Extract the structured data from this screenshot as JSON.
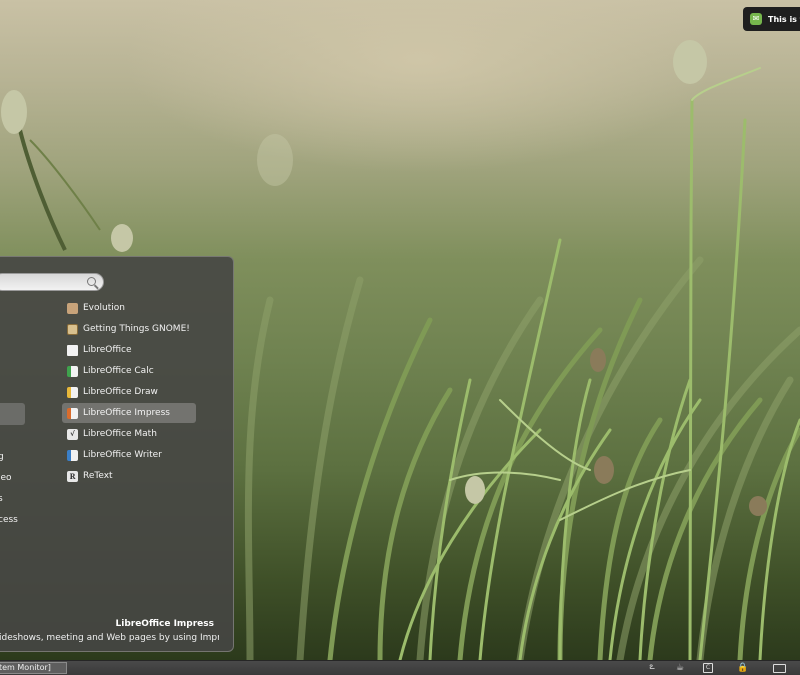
{
  "notification": {
    "text": "This is th",
    "icon": "chat-bubble-icon"
  },
  "menu": {
    "search": {
      "value": "",
      "placeholder": ""
    },
    "categories": [
      {
        "label": "g"
      },
      {
        "label": "leo"
      },
      {
        "label": "s"
      },
      {
        "label": "cess"
      }
    ],
    "applications": [
      {
        "label": "Evolution",
        "icon": "evolution-icon",
        "icon_color": "#c8a37a"
      },
      {
        "label": "Getting Things GNOME!",
        "icon": "gtg-icon",
        "icon_color": "#d8c08e"
      },
      {
        "label": "LibreOffice",
        "icon": "libreoffice-icon",
        "icon_color": "#f2f2f2"
      },
      {
        "label": "LibreOffice Calc",
        "icon": "libreoffice-calc-icon",
        "icon_color": "#3fa34d"
      },
      {
        "label": "LibreOffice Draw",
        "icon": "libreoffice-draw-icon",
        "icon_color": "#e8b83a"
      },
      {
        "label": "LibreOffice Impress",
        "icon": "libreoffice-impress-icon",
        "icon_color": "#d96c2c",
        "selected": true
      },
      {
        "label": "LibreOffice Math",
        "icon": "libreoffice-math-icon",
        "icon_color": "#e0e0e0"
      },
      {
        "label": "LibreOffice Writer",
        "icon": "libreoffice-writer-icon",
        "icon_color": "#3a7fc8"
      },
      {
        "label": "ReText",
        "icon": "retext-icon",
        "icon_color": "#e8e8e8"
      }
    ],
    "description": {
      "title": "LibreOffice Impress",
      "text": "ideshows, meeting and Web pages by using Impress."
    }
  },
  "panel": {
    "task_label": "tem Monitor]",
    "tray_icons": [
      "network-icon",
      "coffee-icon",
      "update-icon",
      "lock-icon",
      "keyboard-icon"
    ]
  }
}
